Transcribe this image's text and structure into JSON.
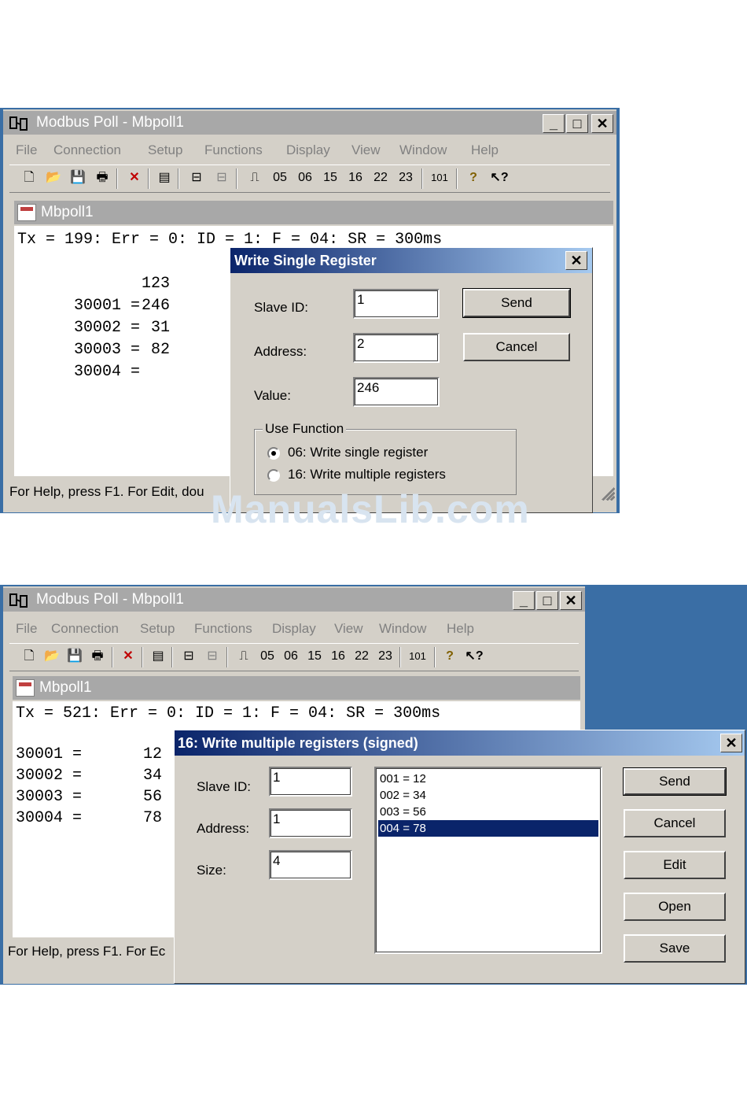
{
  "screen1": {
    "app_title": "Modbus Poll - Mbpoll1",
    "caption_buttons": [
      "_",
      "□",
      "✕"
    ],
    "menu": [
      "File",
      "Connection",
      "Setup",
      "Functions",
      "Display",
      "View",
      "Window",
      "Help"
    ],
    "toolbar_labels": [
      "05",
      "06",
      "15",
      "16",
      "22",
      "23",
      "101"
    ],
    "child_title": "Mbpoll1",
    "status_line": "Tx = 199: Err = 0: ID = 1: F = 04: SR = 300ms",
    "registers": [
      {
        "addr": "30001 =",
        "value": "123"
      },
      {
        "addr": "30002 =",
        "value": "246"
      },
      {
        "addr": "30003 =",
        "value": "31"
      },
      {
        "addr": "30004 =",
        "value": "82"
      }
    ],
    "statusbar": "For Help, press F1.  For Edit, dou",
    "dialog": {
      "title": "Write Single Register",
      "close": "✕",
      "slave_id_label": "Slave ID:",
      "slave_id_value": "1",
      "address_label": "Address:",
      "address_value": "2",
      "value_label": "Value:",
      "value_value": "246",
      "send": "Send",
      "cancel": "Cancel",
      "group_label": "Use Function",
      "option1": "06: Write single register",
      "option2": "16: Write multiple registers",
      "selected_option": "06: Write single register"
    }
  },
  "screen2": {
    "app_title": "Modbus Poll - Mbpoll1",
    "caption_buttons": [
      "_",
      "□",
      "✕"
    ],
    "menu": [
      "File",
      "Connection",
      "Setup",
      "Functions",
      "Display",
      "View",
      "Window",
      "Help"
    ],
    "toolbar_labels": [
      "05",
      "06",
      "15",
      "16",
      "22",
      "23",
      "101"
    ],
    "child_title": "Mbpoll1",
    "status_line": "Tx = 521: Err = 0: ID = 1: F = 04: SR = 300ms",
    "registers": [
      {
        "addr": "30001 =",
        "value": "12"
      },
      {
        "addr": "30002 =",
        "value": "34"
      },
      {
        "addr": "30003 =",
        "value": "56"
      },
      {
        "addr": "30004 =",
        "value": "78"
      }
    ],
    "statusbar": "For Help, press F1.  For Ec",
    "dialog": {
      "title": "16: Write multiple registers (signed)",
      "close": "✕",
      "slave_id_label": "Slave ID:",
      "slave_id_value": "1",
      "address_label": "Address:",
      "address_value": "1",
      "size_label": "Size:",
      "size_value": "4",
      "list": [
        "001 = 12",
        "002 = 34",
        "003 = 56",
        "004 = 78"
      ],
      "selected_index": 3,
      "buttons": [
        "Send",
        "Cancel",
        "Edit",
        "Open",
        "Save"
      ]
    }
  },
  "watermark": "ManualsLib.com",
  "colors": {
    "desktop": "#3a6ea5",
    "dialog_title": "#0a246a",
    "selection": "#0a246a",
    "inactive_title": "#a8a8a8",
    "face": "#d4d0c8"
  }
}
